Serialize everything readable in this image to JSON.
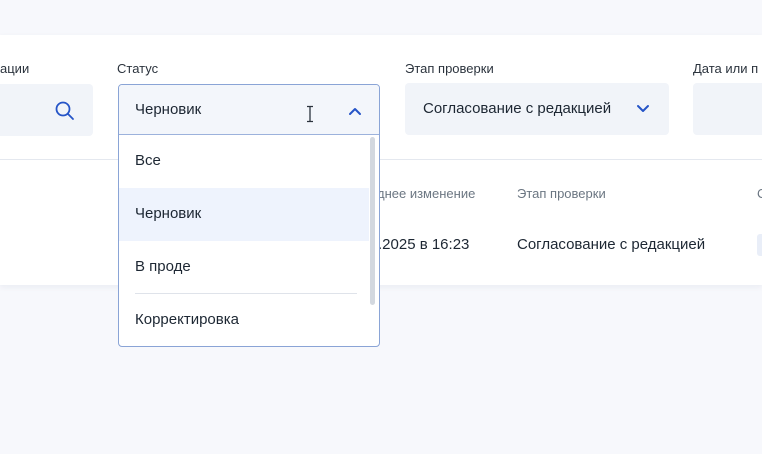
{
  "filters": {
    "publication_label_partial": "ации",
    "status_label": "Статус",
    "status_value": "Черновик",
    "stage_label": "Этап проверки",
    "stage_value": "Согласование с редакцией",
    "date_label_partial": "Дата или п"
  },
  "status_dropdown": {
    "options": [
      "Все",
      "Черновик",
      "В проде",
      "Корректировка"
    ],
    "selected": "Черновик"
  },
  "table": {
    "headers": {
      "last_change_partial": "днее изменение",
      "stage": "Этап проверки",
      "next_partial": "С"
    },
    "rows": [
      {
        "last_change_partial": ".2025 в 16:23",
        "stage": "Согласование с редакцией"
      }
    ]
  },
  "icons": {
    "search": "search-icon",
    "chevron_up": "chevron-up-icon",
    "chevron_down": "chevron-down-icon",
    "cursor": "text-cursor-icon"
  },
  "colors": {
    "accent": "#2554c7",
    "field_bg": "#f1f4f9",
    "dropdown_border": "#8aa4d6",
    "selected_bg": "#eef3fd"
  }
}
